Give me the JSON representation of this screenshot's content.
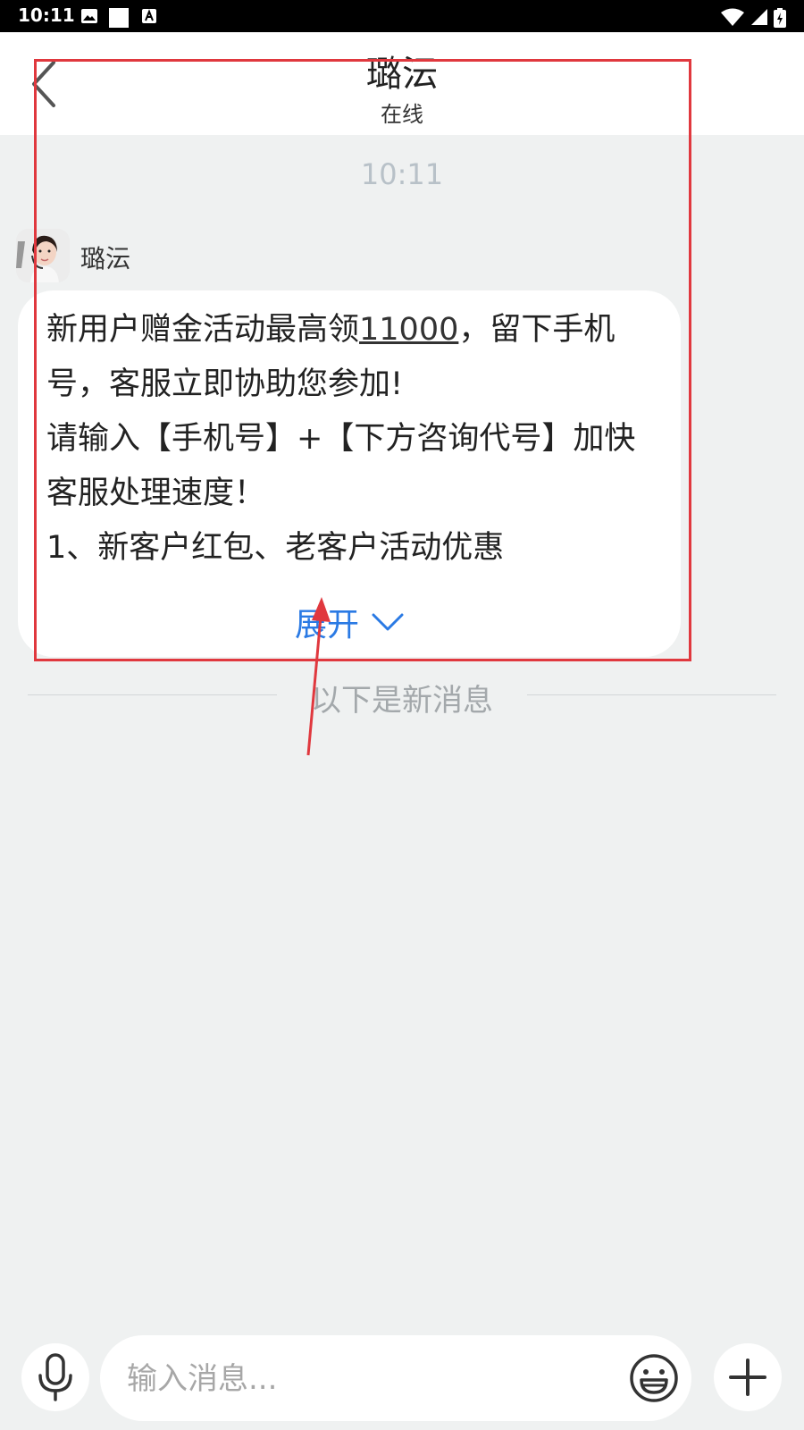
{
  "status_bar": {
    "time": "10:11"
  },
  "header": {
    "title": "璐沄",
    "subtitle": "在线"
  },
  "chat": {
    "timestamp": "10:11",
    "agent_name": "璐沄",
    "message": {
      "line1_pre": "新用户赠金活动最高领",
      "line1_link": "11000",
      "line1_post": "，留下手机",
      "line2": "号，客服立即协助您参加!",
      "line3": "请输入【手机号】+【下方咨询代号】加快",
      "line4": "客服处理速度！",
      "line5": "1、新客户红包、老客户活动优惠"
    },
    "expand_label": "展开",
    "new_messages_divider": "以下是新消息"
  },
  "input": {
    "placeholder": "输入消息..."
  },
  "colors": {
    "accent": "#2a7ae4",
    "annotation": "#e0383e",
    "background": "#eff1f1"
  },
  "icons": {
    "back": "chevron-left-icon",
    "expand": "chevron-down-icon",
    "mic": "microphone-icon",
    "emoji": "smiley-icon",
    "plus": "plus-icon"
  }
}
